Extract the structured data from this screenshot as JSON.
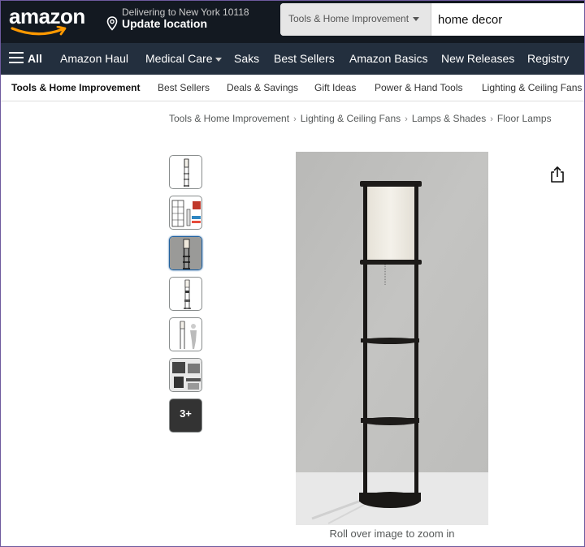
{
  "header": {
    "logo_text": "amazon",
    "delivery_line1": "Delivering to New York 10118",
    "delivery_line2": "Update location",
    "search_category": "Tools & Home Improvement",
    "search_value": "home decor"
  },
  "nav": {
    "all_label": "All",
    "items": [
      "Amazon Haul",
      "Medical Care",
      "Saks",
      "Best Sellers",
      "Amazon Basics",
      "New Releases",
      "Registry"
    ]
  },
  "subnav": {
    "items": [
      "Tools & Home Improvement",
      "Best Sellers",
      "Deals & Savings",
      "Gift Ideas",
      "Power & Hand Tools",
      "Lighting & Ceiling Fans"
    ]
  },
  "breadcrumb": [
    "Tools & Home Improvement",
    "Lighting & Ceiling Fans",
    "Lamps & Shades",
    "Floor Lamps"
  ],
  "gallery": {
    "more_label": "3+",
    "zoom_caption": "Roll over image to zoom in"
  },
  "icons": [
    "location-pin-icon",
    "chevron-down-icon",
    "hamburger-menu-icon",
    "share-icon"
  ]
}
